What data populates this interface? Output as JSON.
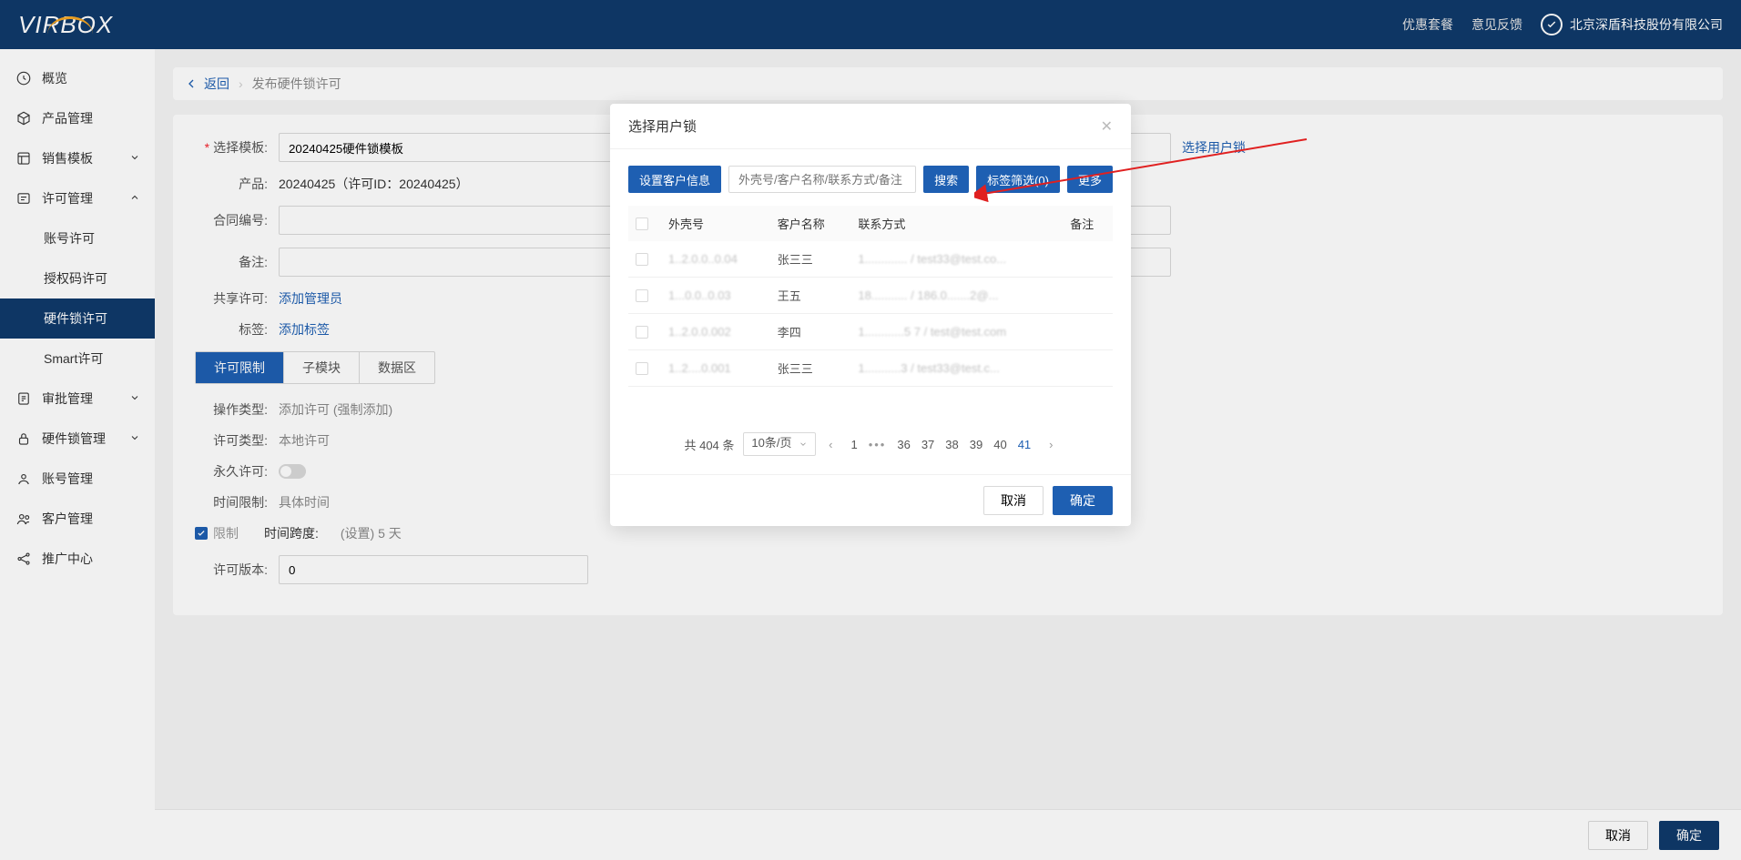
{
  "header": {
    "logo": "VIRBOX",
    "links": {
      "plan": "优惠套餐",
      "feedback": "意见反馈"
    },
    "company": "北京深盾科技股份有限公司"
  },
  "sidebar": {
    "items": [
      {
        "key": "overview",
        "label": "概览"
      },
      {
        "key": "product",
        "label": "产品管理"
      },
      {
        "key": "salestpl",
        "label": "销售模板",
        "chev": "down"
      },
      {
        "key": "license",
        "label": "许可管理",
        "chev": "up"
      },
      {
        "key": "acctlic",
        "label": "账号许可",
        "sub": true
      },
      {
        "key": "authcode",
        "label": "授权码许可",
        "sub": true
      },
      {
        "key": "hwlic",
        "label": "硬件锁许可",
        "sub": true,
        "active": true
      },
      {
        "key": "smart",
        "label": "Smart许可",
        "sub": true
      },
      {
        "key": "approval",
        "label": "审批管理",
        "chev": "down"
      },
      {
        "key": "hwlock",
        "label": "硬件锁管理",
        "chev": "down"
      },
      {
        "key": "acctmgr",
        "label": "账号管理"
      },
      {
        "key": "customer",
        "label": "客户管理"
      },
      {
        "key": "promote",
        "label": "推广中心"
      }
    ]
  },
  "breadcrumb": {
    "back": "返回",
    "current": "发布硬件锁许可"
  },
  "form": {
    "tpl_label": "选择模板:",
    "tpl_value": "20240425硬件锁模板",
    "product_label": "产品:",
    "product_value": "20240425（许可ID：20240425）",
    "contract_label": "合同编号:",
    "remark_label": "备注:",
    "share_label": "共享许可:",
    "share_link": "添加管理员",
    "tag_label": "标签:",
    "tag_link": "添加标签",
    "select_lock": "选择用户锁"
  },
  "tabs": {
    "t1": "许可限制",
    "t2": "子模块",
    "t3": "数据区"
  },
  "limits": {
    "op_label": "操作类型:",
    "op_value": "添加许可 (强制添加)",
    "type_label": "许可类型:",
    "type_value": "本地许可",
    "perm_label": "永久许可:",
    "time_label": "时间限制:",
    "time_value": "具体时间",
    "limit_cb": "限制",
    "span_label": "时间跨度:",
    "span_value": "(设置) 5 天",
    "ver_label": "许可版本:",
    "ver_value": "0"
  },
  "footer": {
    "cancel": "取消",
    "ok": "确定"
  },
  "modal": {
    "title": "选择用户锁",
    "set_customer": "设置客户信息",
    "search_ph": "外壳号/客户名称/联系方式/备注",
    "search_btn": "搜索",
    "tag_filter": "标签筛选(0)",
    "more": "更多",
    "cols": {
      "shell": "外壳号",
      "name": "客户名称",
      "contact": "联系方式",
      "remark": "备注"
    },
    "rows": [
      {
        "shell": "1..2.0.0..0.04",
        "name": "张三三",
        "contact": "1............. / test33@test.co..."
      },
      {
        "shell": "1...0.0..0.03",
        "name": "王五",
        "contact": "18........... / 186.0.......2@..."
      },
      {
        "shell": "1..2.0.0.002",
        "name": "李四",
        "contact": "1............5 7 / test@test.com"
      },
      {
        "shell": "1..2....0.001",
        "name": "张三三",
        "contact": "1...........3 / test33@test.c..."
      }
    ],
    "pagination": {
      "total": "共 404 条",
      "page_size": "10条/页",
      "pages": [
        "1",
        "…",
        "36",
        "37",
        "38",
        "39",
        "40",
        "41"
      ],
      "active": "41"
    },
    "cancel": "取消",
    "ok": "确定"
  }
}
